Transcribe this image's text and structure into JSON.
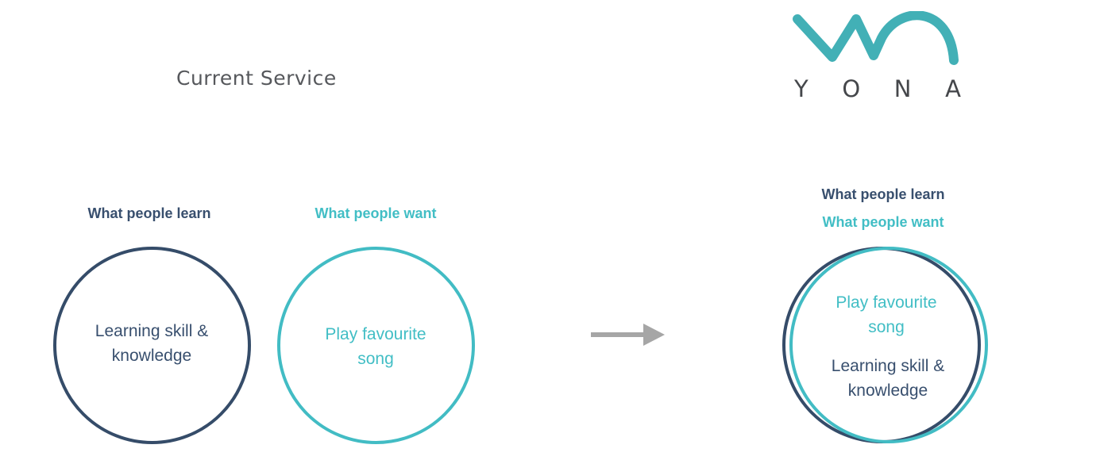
{
  "left_panel": {
    "title": "Current Service",
    "learn_heading": "What people learn",
    "want_heading": "What people want",
    "learn_circle": {
      "line1": "Learning skill &",
      "line2": "knowledge"
    },
    "want_circle": {
      "line1": "Play favourite",
      "line2": "song"
    }
  },
  "right_panel": {
    "logo": {
      "wordmark": "YONA",
      "letters": [
        "Y",
        "O",
        "N",
        "A"
      ]
    },
    "learn_heading": "What people learn",
    "want_heading": "What people want",
    "combined_circle": {
      "want_line1": "Play favourite",
      "want_line2": "song",
      "learn_line1": "Learning skill &",
      "learn_line2": "knowledge"
    }
  },
  "colors": {
    "navy": "#354c69",
    "teal": "#42bcc4",
    "arrow_gray": "#a6a6a6",
    "title_gray": "#56585c"
  },
  "icons": {
    "arrow": "right-arrow-icon",
    "logo": "yona-logo"
  }
}
